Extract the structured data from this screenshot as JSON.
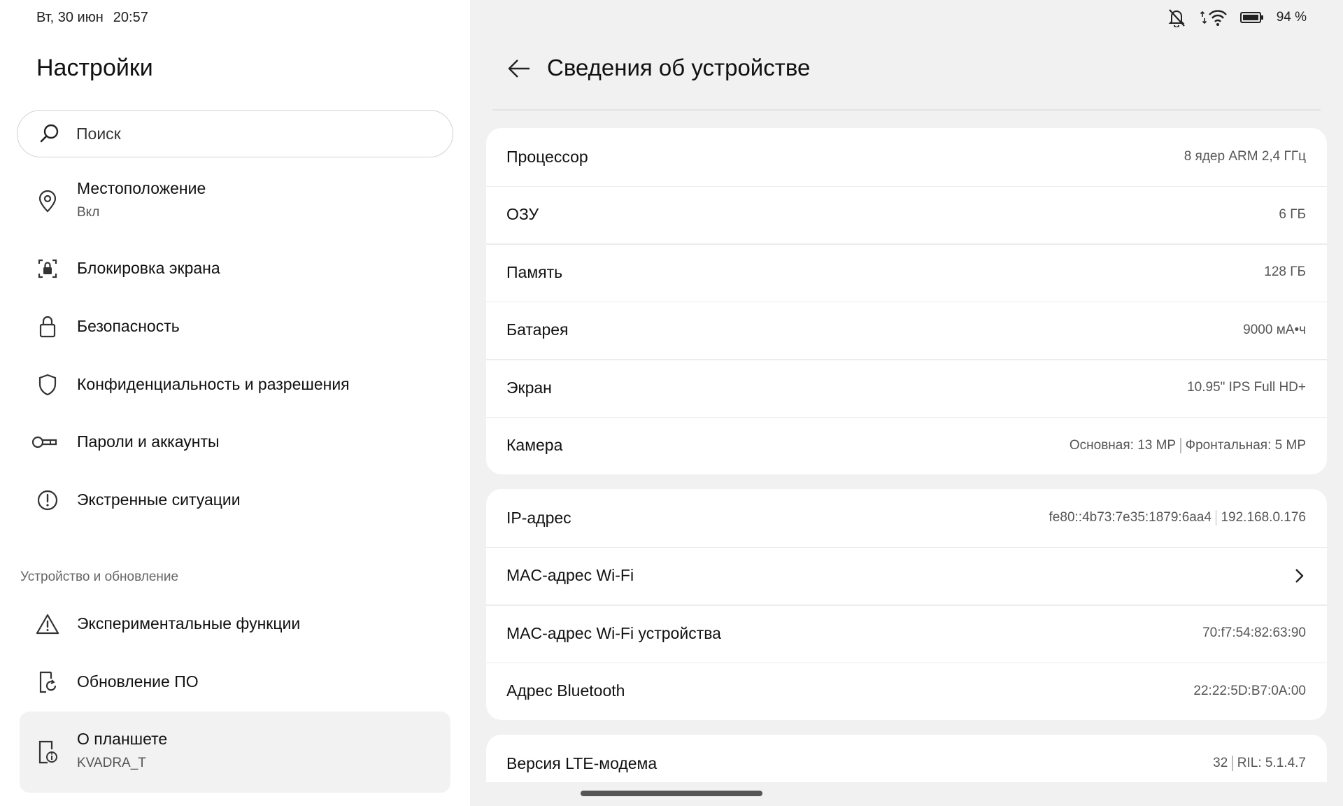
{
  "status_left": {
    "date": "Вт, 30 июн",
    "time": "20:57"
  },
  "status_right": {
    "battery_text": "94 %",
    "icons": [
      "bell-off-icon",
      "wifi-icon",
      "battery-icon"
    ]
  },
  "app_title": "Настройки",
  "search": {
    "placeholder": "Поиск"
  },
  "nav": {
    "location": {
      "label": "Местоположение",
      "sub": "Вкл",
      "icon": "location-pin-icon"
    },
    "screen_lock": {
      "label": "Блокировка экрана",
      "icon": "screen-lock-icon"
    },
    "security": {
      "label": "Безопасность",
      "icon": "lock-icon"
    },
    "privacy": {
      "label": "Конфиденциальность и разрешения",
      "icon": "shield-icon"
    },
    "passwords": {
      "label": "Пароли и аккаунты",
      "icon": "key-icon"
    },
    "emergency": {
      "label": "Экстренные ситуации",
      "icon": "alert-circle-icon"
    },
    "section_device": "Устройство и обновление",
    "experimental": {
      "label": "Экспериментальные функции",
      "icon": "warning-triangle-icon"
    },
    "update": {
      "label": "Обновление ПО",
      "icon": "update-icon"
    },
    "about": {
      "label": "О планшете",
      "sub": "KVADRA_T",
      "icon": "tablet-info-icon"
    }
  },
  "page": {
    "title": "Сведения об устройстве"
  },
  "specs": {
    "processor": {
      "label": "Процессор",
      "value": "8 ядер ARM 2,4 ГГц"
    },
    "ram": {
      "label": "ОЗУ",
      "value": "6 ГБ"
    },
    "storage": {
      "label": "Память",
      "value": "128 ГБ"
    },
    "battery": {
      "label": "Батарея",
      "value": "9000 мА•ч"
    },
    "screen": {
      "label": "Экран",
      "value": "10.95\" IPS Full HD+"
    },
    "camera": {
      "label": "Камера",
      "value_main": "Основная: 13 MP",
      "value_front": "Фронтальная: 5 MP"
    }
  },
  "network": {
    "ip": {
      "label": "IP-адрес",
      "value_v6": "fe80::4b73:7e35:1879:6aa4",
      "value_v4": "192.168.0.176"
    },
    "wifi_mac": {
      "label": "MAC-адрес Wi-Fi"
    },
    "wifi_mac_device": {
      "label": "MAC-адрес Wi-Fi устройства",
      "value": "70:f7:54:82:63:90"
    },
    "bluetooth": {
      "label": "Адрес Bluetooth",
      "value": "22:22:5D:B7:0A:00"
    }
  },
  "modem": {
    "label": "Версия LTE-модема",
    "value_a": "32",
    "value_b": "RIL: 5.1.4.7"
  }
}
